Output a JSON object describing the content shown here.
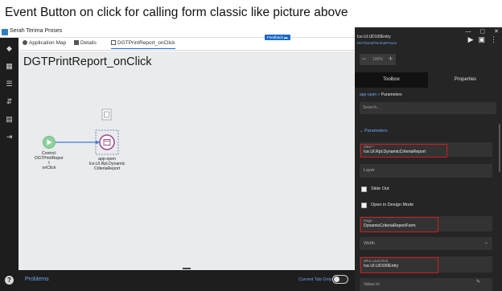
{
  "caption": "Event Button on click for calling form classic like picture above",
  "window": {
    "title": "Serah Terima Proses",
    "controls": [
      "—",
      "▢",
      "✕"
    ]
  },
  "tabs": [
    {
      "label": "Application Map",
      "icon": "map-icon"
    },
    {
      "label": "Details",
      "icon": "details-icon"
    },
    {
      "label": "DGTPrintReport_onClick",
      "icon": "workflow-icon",
      "active": true
    }
  ],
  "feedback_label": "Feedback",
  "page_title": "DGTPrintReport_onClick",
  "nodes": {
    "control": {
      "line1": "Control:",
      "line2": "DGTPrintRepor",
      "line3": "t",
      "line4": "onClick"
    },
    "app_open": {
      "line1": "app-open",
      "line2": "Ice.UI.Rpt.Dynamic",
      "line3": "CriteriaReport"
    }
  },
  "bottom": {
    "problems_label": "Problems",
    "current_tab_label": "Current Tab Only"
  },
  "right": {
    "title": "Ice.UI.UD100Entry",
    "subtitle": "DGTSerahTerimaProses",
    "zoom_value": "100%",
    "tabs": {
      "toolbox": "Toolbox",
      "properties": "Properties"
    },
    "breadcrumb": {
      "root": "app-open",
      "sep": ">",
      "current": "Parameters"
    },
    "search_placeholder": "Search...",
    "section_label": "Parameters",
    "view": {
      "label": "View *",
      "value": "Ice.UI.Rpt.DynamicCriteriaReport"
    },
    "layer": {
      "placeholder": "Layer"
    },
    "slide_out": {
      "label": "Slide Out"
    },
    "design_mode": {
      "label": "Open in Design Mode"
    },
    "page": {
      "label": "Page",
      "value": "DynamicCriteriaReportForm"
    },
    "width": {
      "placeholder": "Width"
    },
    "who_launched": {
      "label": "Who Launched",
      "value": "Ice.UI.UD100Entry"
    },
    "value_in": {
      "placeholder": "Value In"
    }
  },
  "colors": {
    "accent": "#1c6ac7",
    "highlight": "#d21c1c",
    "node_green": "#8fd19e",
    "node_purple": "#a04c8c"
  }
}
